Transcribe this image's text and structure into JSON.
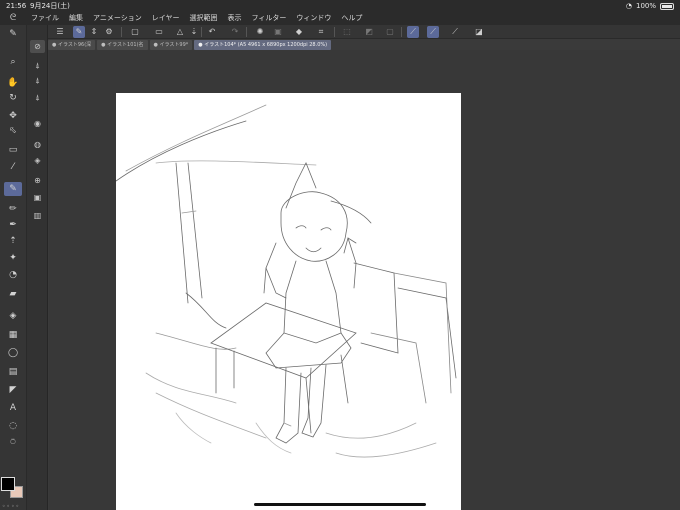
{
  "status": {
    "time": "21:56",
    "date": "9月24日(土)",
    "battery_text": "100%",
    "battery_level": 1.0
  },
  "menu": {
    "items": [
      "ファイル",
      "編集",
      "アニメーション",
      "レイヤー",
      "選択範囲",
      "表示",
      "フィルター",
      "ウィンドウ",
      "ヘルプ"
    ]
  },
  "tabs": [
    "● イラスト96(深",
    "● イラスト101(名",
    "● イラスト99*",
    "● イラスト104* (A5 4961 x 6890px 1200dpi 28.0%)"
  ],
  "active_tab_index": 3,
  "toolbar_icons": [
    "menu-icon",
    "brush-icon",
    "updown-icon",
    "settings-icon",
    "new-icon",
    "open-icon",
    "save-icon",
    "undo-icon",
    "redo-icon",
    "transform-icon",
    "layer-icon",
    "fill-icon",
    "crop-icon",
    "ruler-icon",
    "snap-icon",
    "line-icon",
    "pen-stroke-icon",
    "fill-stroke-icon"
  ],
  "tools": [
    {
      "name": "zoom-tool-icon",
      "glyph": "⌕"
    },
    {
      "name": "hand-tool-icon",
      "glyph": "✋"
    },
    {
      "name": "rotate-zoom-icon",
      "glyph": "↻"
    },
    {
      "name": "move-tool-icon",
      "glyph": "✥"
    },
    {
      "name": "select-arrow-icon",
      "glyph": "⬁"
    },
    {
      "name": "rect-select-icon",
      "glyph": "▭"
    },
    {
      "name": "eyedropper-icon",
      "glyph": "⁄"
    },
    {
      "name": "pen-tool-icon",
      "glyph": "✎"
    },
    {
      "name": "pencil-tool-icon",
      "glyph": "✏"
    },
    {
      "name": "brush-tool-icon",
      "glyph": "✒"
    },
    {
      "name": "airbrush-icon",
      "glyph": "⇡"
    },
    {
      "name": "decoration-icon",
      "glyph": "✦"
    },
    {
      "name": "blend-icon",
      "glyph": "◔"
    },
    {
      "name": "eraser-icon",
      "glyph": "▰"
    },
    {
      "name": "fill-bucket-icon",
      "glyph": "◈"
    },
    {
      "name": "gradient-icon",
      "glyph": "▦"
    },
    {
      "name": "figure-icon",
      "glyph": "◯"
    },
    {
      "name": "frame-icon",
      "glyph": "▤"
    },
    {
      "name": "ruler-icon",
      "glyph": "◤"
    },
    {
      "name": "text-tool-icon",
      "glyph": "A"
    },
    {
      "name": "balloon-icon",
      "glyph": "◌"
    },
    {
      "name": "correction-icon",
      "glyph": "⍥"
    }
  ],
  "active_tool_index": 7,
  "subtools": [
    {
      "name": "subtool-1-icon",
      "glyph": "⊘"
    },
    {
      "name": "subtool-2-icon",
      "glyph": "⍋"
    },
    {
      "name": "subtool-3-icon",
      "glyph": "⍋"
    },
    {
      "name": "subtool-4-icon",
      "glyph": "⍋"
    },
    {
      "name": "subtool-5-icon",
      "glyph": "◉"
    },
    {
      "name": "subtool-6-icon",
      "glyph": "◍"
    },
    {
      "name": "subtool-7-icon",
      "glyph": "◈"
    },
    {
      "name": "subtool-8-icon",
      "glyph": "⊕"
    },
    {
      "name": "subtool-9-icon",
      "glyph": "▣"
    },
    {
      "name": "subtool-10-icon",
      "glyph": "▥"
    }
  ],
  "colors": {
    "foreground": "#000000",
    "background": "#e8c9b9",
    "accent": "#5c6a9a"
  }
}
